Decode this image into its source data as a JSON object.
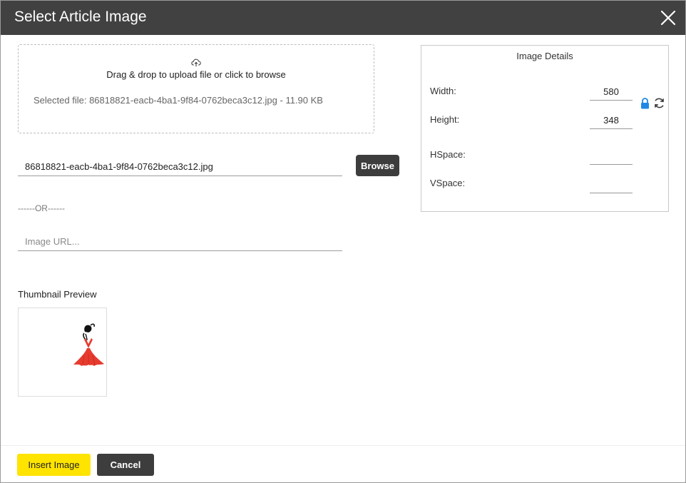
{
  "dialog": {
    "title": "Select Article Image"
  },
  "upload": {
    "drop_text": "Drag & drop to upload file or click to browse",
    "selected_label": "Selected file:",
    "selected_file": "86818821-eacb-4ba1-9f84-0762beca3c12.jpg",
    "file_size": "11.90 KB"
  },
  "file_field": {
    "value": "86818821-eacb-4ba1-9f84-0762beca3c12.jpg"
  },
  "browse_label": "Browse",
  "or_text": "------OR------",
  "url_field": {
    "value": "",
    "placeholder": "Image URL..."
  },
  "thumbnail": {
    "label": "Thumbnail Preview"
  },
  "details": {
    "title": "Image Details",
    "width_label": "Width:",
    "width_value": "580",
    "height_label": "Height:",
    "height_value": "348",
    "hspace_label": "HSpace:",
    "hspace_value": "",
    "vspace_label": "VSpace:",
    "vspace_value": ""
  },
  "footer": {
    "insert_label": "Insert Image",
    "cancel_label": "Cancel"
  },
  "colors": {
    "titlebar": "#414141",
    "primary_button": "#ffe400",
    "dark_button": "#3d3d3d",
    "lock_icon": "#1e88e5"
  },
  "icons": [
    "close-icon",
    "cloud-upload-icon",
    "lock-icon",
    "refresh-icon"
  ]
}
